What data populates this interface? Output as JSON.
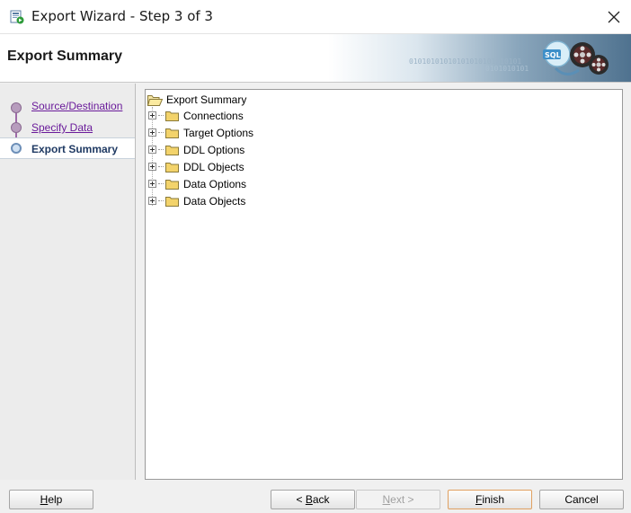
{
  "window": {
    "title": "Export Wizard - Step 3 of 3",
    "close_symbol": "✕"
  },
  "header": {
    "title": "Export Summary",
    "binary_text_1": "01010101010101010101010101",
    "binary_text_2": "0101010101",
    "graphic_icon": "sql-export-reels-icon"
  },
  "steps": [
    {
      "label": "Source/Destination",
      "state": "completed"
    },
    {
      "label": "Specify Data",
      "state": "completed"
    },
    {
      "label": "Export Summary",
      "state": "current"
    }
  ],
  "tree": {
    "root_label": "Export Summary",
    "items": [
      {
        "label": "Connections"
      },
      {
        "label": "Target Options"
      },
      {
        "label": "DDL Options"
      },
      {
        "label": "DDL Objects"
      },
      {
        "label": "Data Options"
      },
      {
        "label": "Data Objects"
      }
    ]
  },
  "buttons": {
    "help": {
      "mnemonic": "H",
      "rest": "elp"
    },
    "back": {
      "prefix": "< ",
      "mnemonic": "B",
      "rest": "ack"
    },
    "next": {
      "mnemonic": "N",
      "rest": "ext >",
      "enabled": false
    },
    "finish": {
      "mnemonic": "F",
      "rest": "inish"
    },
    "cancel": {
      "label": "Cancel"
    }
  },
  "colors": {
    "link_visited": "#6a1b9a",
    "current_step": "#1f3a63",
    "folder": "#f3d36b"
  }
}
